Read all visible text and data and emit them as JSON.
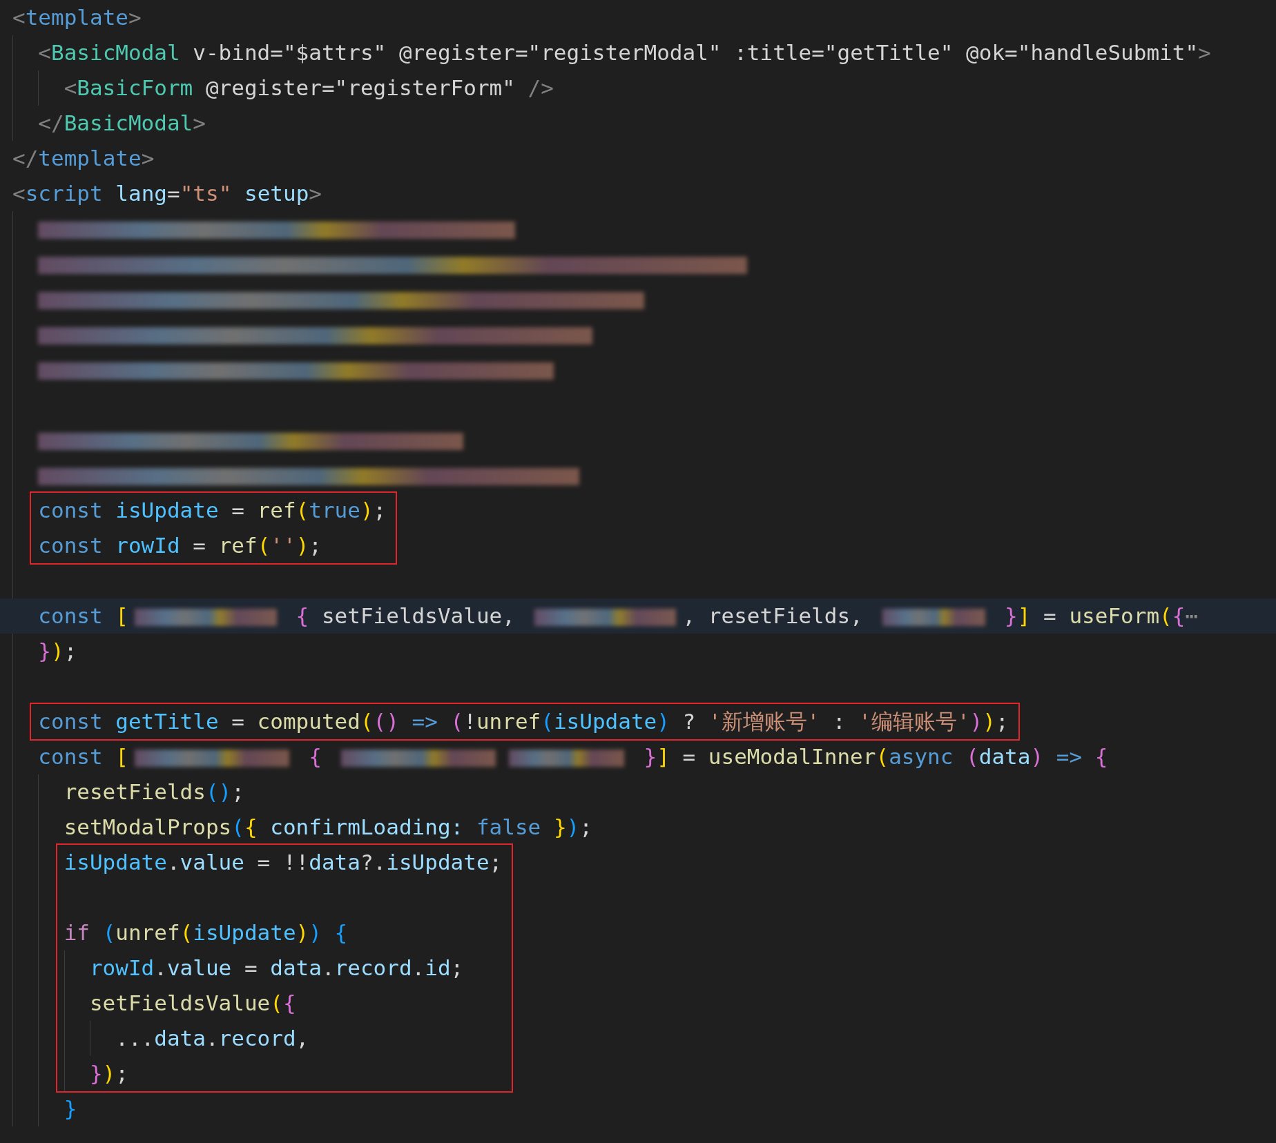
{
  "lines": [
    {
      "kind": "line",
      "highlighted": false,
      "tokens": [
        {
          "text": "<",
          "kind": "punct"
        },
        {
          "text": "template",
          "kind": "tag"
        },
        {
          "text": ">",
          "kind": "punct"
        }
      ],
      "children": [
        {
          "kind": "line",
          "highlighted": false,
          "tokens": [
            {
              "text": "<",
              "kind": "punct"
            },
            {
              "text": "BasicModal",
              "kind": "component"
            },
            {
              "text": " v-bind=\"$attrs\" @register=\"registerModal\" :title=\"getTitle\" @ok=\"handleSubmit\"",
              "kind": "plain"
            },
            {
              "text": ">",
              "kind": "punct"
            }
          ],
          "children": [
            {
              "kind": "line",
              "highlighted": false,
              "tokens": [
                {
                  "text": "<",
                  "kind": "punct"
                },
                {
                  "text": "BasicForm",
                  "kind": "component"
                },
                {
                  "text": " @register=\"registerForm\"",
                  "kind": "plain"
                },
                {
                  "text": " />",
                  "kind": "punct"
                }
              ]
            }
          ]
        },
        {
          "kind": "line",
          "highlighted": false,
          "tokens": [
            {
              "text": "</",
              "kind": "punct"
            },
            {
              "text": "BasicModal",
              "kind": "component"
            },
            {
              "text": ">",
              "kind": "punct"
            }
          ]
        }
      ]
    },
    {
      "kind": "line",
      "highlighted": false,
      "tokens": [
        {
          "text": "</",
          "kind": "punct"
        },
        {
          "text": "template",
          "kind": "tag"
        },
        {
          "text": ">",
          "kind": "punct"
        }
      ]
    },
    {
      "kind": "line",
      "highlighted": false,
      "tokens": [
        {
          "text": "<",
          "kind": "punct"
        },
        {
          "text": "script",
          "kind": "tag"
        },
        {
          "text": " lang",
          "kind": "attr"
        },
        {
          "text": "=",
          "kind": "plain"
        },
        {
          "text": "\"ts\"",
          "kind": "string"
        },
        {
          "text": " setup",
          "kind": "attr"
        },
        {
          "text": ">",
          "kind": "punct"
        }
      ],
      "children": [
        {
          "kind": "line",
          "highlighted": false,
          "tokens": [
            {
              "kind": "blurred"
            }
          ]
        },
        {
          "kind": "line",
          "highlighted": false,
          "tokens": [
            {
              "kind": "blurred"
            }
          ]
        },
        {
          "kind": "line",
          "highlighted": false,
          "tokens": [
            {
              "kind": "blurred"
            }
          ]
        },
        {
          "kind": "line",
          "highlighted": false,
          "tokens": [
            {
              "kind": "blurred"
            }
          ]
        },
        {
          "kind": "line",
          "highlighted": false,
          "tokens": [
            {
              "kind": "blurred"
            }
          ]
        },
        {
          "kind": "blank"
        },
        {
          "kind": "line",
          "highlighted": false,
          "tokens": [
            {
              "kind": "blurred"
            }
          ]
        },
        {
          "kind": "line",
          "highlighted": false,
          "tokens": [
            {
              "kind": "blurred"
            }
          ]
        },
        {
          "kind": "box",
          "items": [
            {
              "kind": "line",
              "highlighted": false,
              "tokens": [
                {
                  "text": "const ",
                  "kind": "keyword"
                },
                {
                  "text": "isUpdate",
                  "kind": "constvar"
                },
                {
                  "text": " = ",
                  "kind": "plain"
                },
                {
                  "text": "ref",
                  "kind": "func"
                },
                {
                  "text": "(",
                  "kind": "b1"
                },
                {
                  "text": "true",
                  "kind": "keyword"
                },
                {
                  "text": ")",
                  "kind": "b1"
                },
                {
                  "text": ";",
                  "kind": "plain"
                }
              ]
            },
            {
              "kind": "line",
              "highlighted": false,
              "tokens": [
                {
                  "text": "const ",
                  "kind": "keyword"
                },
                {
                  "text": "rowId",
                  "kind": "constvar"
                },
                {
                  "text": " = ",
                  "kind": "plain"
                },
                {
                  "text": "ref",
                  "kind": "func"
                },
                {
                  "text": "(",
                  "kind": "b1"
                },
                {
                  "text": "''",
                  "kind": "string"
                },
                {
                  "text": ")",
                  "kind": "b1"
                },
                {
                  "text": ";",
                  "kind": "plain"
                }
              ]
            }
          ]
        },
        {
          "kind": "blank"
        },
        {
          "kind": "line",
          "highlighted": true,
          "tokens": [
            {
              "text": "const ",
              "kind": "keyword"
            },
            {
              "text": "[",
              "kind": "b1"
            },
            {
              "kind": "blurred"
            },
            {
              "text": " {",
              "kind": "b2"
            },
            {
              "text": " setFieldsValue, ",
              "kind": "plain"
            },
            {
              "kind": "blurred"
            },
            {
              "text": ", resetFields, ",
              "kind": "plain"
            },
            {
              "kind": "blurred"
            },
            {
              "text": " }",
              "kind": "b2"
            },
            {
              "text": "]",
              "kind": "b1"
            },
            {
              "text": " = ",
              "kind": "plain"
            },
            {
              "text": "useForm",
              "kind": "func"
            },
            {
              "text": "(",
              "kind": "b1"
            },
            {
              "text": "{",
              "kind": "b2"
            },
            {
              "text": "⋯",
              "kind": "fold"
            }
          ]
        },
        {
          "kind": "line",
          "highlighted": false,
          "tokens": [
            {
              "text": "}",
              "kind": "b2"
            },
            {
              "text": ")",
              "kind": "b1"
            },
            {
              "text": ";",
              "kind": "plain"
            }
          ]
        },
        {
          "kind": "blank"
        },
        {
          "kind": "box",
          "items": [
            {
              "kind": "line",
              "highlighted": false,
              "tokens": [
                {
                  "text": "const ",
                  "kind": "keyword"
                },
                {
                  "text": "getTitle",
                  "kind": "constvar"
                },
                {
                  "text": " = ",
                  "kind": "plain"
                },
                {
                  "text": "computed",
                  "kind": "func"
                },
                {
                  "text": "(",
                  "kind": "b1"
                },
                {
                  "text": "() ",
                  "kind": "b2"
                },
                {
                  "text": "=> ",
                  "kind": "keyword"
                },
                {
                  "text": "(",
                  "kind": "b2"
                },
                {
                  "text": "!",
                  "kind": "plain"
                },
                {
                  "text": "unref",
                  "kind": "func"
                },
                {
                  "text": "(",
                  "kind": "b3"
                },
                {
                  "text": "isUpdate",
                  "kind": "constvar"
                },
                {
                  "text": ")",
                  "kind": "b3"
                },
                {
                  "text": " ? ",
                  "kind": "plain"
                },
                {
                  "text": "'新增账号'",
                  "kind": "string"
                },
                {
                  "text": " : ",
                  "kind": "plain"
                },
                {
                  "text": "'编辑账号'",
                  "kind": "string"
                },
                {
                  "text": ")",
                  "kind": "b2"
                },
                {
                  "text": ")",
                  "kind": "b1"
                },
                {
                  "text": ";",
                  "kind": "plain"
                }
              ]
            }
          ]
        },
        {
          "kind": "line",
          "highlighted": false,
          "tokens": [
            {
              "text": "const ",
              "kind": "keyword"
            },
            {
              "text": "[",
              "kind": "b1"
            },
            {
              "kind": "blurred"
            },
            {
              "text": " { ",
              "kind": "b2"
            },
            {
              "kind": "blurred"
            },
            {
              "kind": "blurred"
            },
            {
              "text": " }",
              "kind": "b2"
            },
            {
              "text": "]",
              "kind": "b1"
            },
            {
              "text": " = ",
              "kind": "plain"
            },
            {
              "text": "useModalInner",
              "kind": "func"
            },
            {
              "text": "(",
              "kind": "b1"
            },
            {
              "text": "async ",
              "kind": "keyword"
            },
            {
              "text": "(",
              "kind": "b2"
            },
            {
              "text": "data",
              "kind": "var"
            },
            {
              "text": ") ",
              "kind": "b2"
            },
            {
              "text": "=> ",
              "kind": "keyword"
            },
            {
              "text": "{",
              "kind": "b2"
            }
          ],
          "children": [
            {
              "kind": "line",
              "highlighted": false,
              "tokens": [
                {
                  "text": "resetFields",
                  "kind": "func"
                },
                {
                  "text": "()",
                  "kind": "b3"
                },
                {
                  "text": ";",
                  "kind": "plain"
                }
              ]
            },
            {
              "kind": "line",
              "highlighted": false,
              "tokens": [
                {
                  "text": "setModalProps",
                  "kind": "func"
                },
                {
                  "text": "(",
                  "kind": "b3"
                },
                {
                  "text": "{",
                  "kind": "b1"
                },
                {
                  "text": " confirmLoading: ",
                  "kind": "var"
                },
                {
                  "text": "false ",
                  "kind": "keyword"
                },
                {
                  "text": "}",
                  "kind": "b1"
                },
                {
                  "text": ")",
                  "kind": "b3"
                },
                {
                  "text": ";",
                  "kind": "plain"
                }
              ]
            },
            {
              "kind": "box",
              "items": [
                {
                  "kind": "line",
                  "highlighted": false,
                  "tokens": [
                    {
                      "text": "isUpdate",
                      "kind": "constvar"
                    },
                    {
                      "text": ".",
                      "kind": "plain"
                    },
                    {
                      "text": "value",
                      "kind": "var"
                    },
                    {
                      "text": " = !!",
                      "kind": "plain"
                    },
                    {
                      "text": "data",
                      "kind": "var"
                    },
                    {
                      "text": "?.",
                      "kind": "plain"
                    },
                    {
                      "text": "isUpdate",
                      "kind": "var"
                    },
                    {
                      "text": ";",
                      "kind": "plain"
                    }
                  ]
                },
                {
                  "kind": "blank"
                },
                {
                  "kind": "line",
                  "highlighted": false,
                  "tokens": [
                    {
                      "text": "if ",
                      "kind": "control"
                    },
                    {
                      "text": "(",
                      "kind": "b3"
                    },
                    {
                      "text": "unref",
                      "kind": "func"
                    },
                    {
                      "text": "(",
                      "kind": "b1"
                    },
                    {
                      "text": "isUpdate",
                      "kind": "constvar"
                    },
                    {
                      "text": ")",
                      "kind": "b1"
                    },
                    {
                      "text": ") {",
                      "kind": "b3"
                    }
                  ],
                  "children": [
                    {
                      "kind": "line",
                      "highlighted": false,
                      "tokens": [
                        {
                          "text": "rowId",
                          "kind": "constvar"
                        },
                        {
                          "text": ".",
                          "kind": "plain"
                        },
                        {
                          "text": "value",
                          "kind": "var"
                        },
                        {
                          "text": " = ",
                          "kind": "plain"
                        },
                        {
                          "text": "data",
                          "kind": "var"
                        },
                        {
                          "text": ".",
                          "kind": "plain"
                        },
                        {
                          "text": "record",
                          "kind": "var"
                        },
                        {
                          "text": ".",
                          "kind": "plain"
                        },
                        {
                          "text": "id",
                          "kind": "var"
                        },
                        {
                          "text": ";",
                          "kind": "plain"
                        }
                      ]
                    },
                    {
                      "kind": "line",
                      "highlighted": false,
                      "tokens": [
                        {
                          "text": "setFieldsValue",
                          "kind": "func"
                        },
                        {
                          "text": "(",
                          "kind": "b1"
                        },
                        {
                          "text": "{",
                          "kind": "b2"
                        }
                      ],
                      "children": [
                        {
                          "kind": "line",
                          "highlighted": false,
                          "tokens": [
                            {
                              "text": "...",
                              "kind": "plain"
                            },
                            {
                              "text": "data",
                              "kind": "var"
                            },
                            {
                              "text": ".",
                              "kind": "plain"
                            },
                            {
                              "text": "record",
                              "kind": "var"
                            },
                            {
                              "text": ",",
                              "kind": "plain"
                            }
                          ]
                        }
                      ]
                    },
                    {
                      "kind": "line",
                      "highlighted": false,
                      "tokens": [
                        {
                          "text": "}",
                          "kind": "b2"
                        },
                        {
                          "text": ")",
                          "kind": "b1"
                        },
                        {
                          "text": ";",
                          "kind": "plain"
                        }
                      ]
                    }
                  ]
                }
              ]
            },
            {
              "kind": "line",
              "highlighted": false,
              "tokens": [
                {
                  "text": "}",
                  "kind": "b3"
                }
              ]
            }
          ]
        }
      ]
    }
  ]
}
